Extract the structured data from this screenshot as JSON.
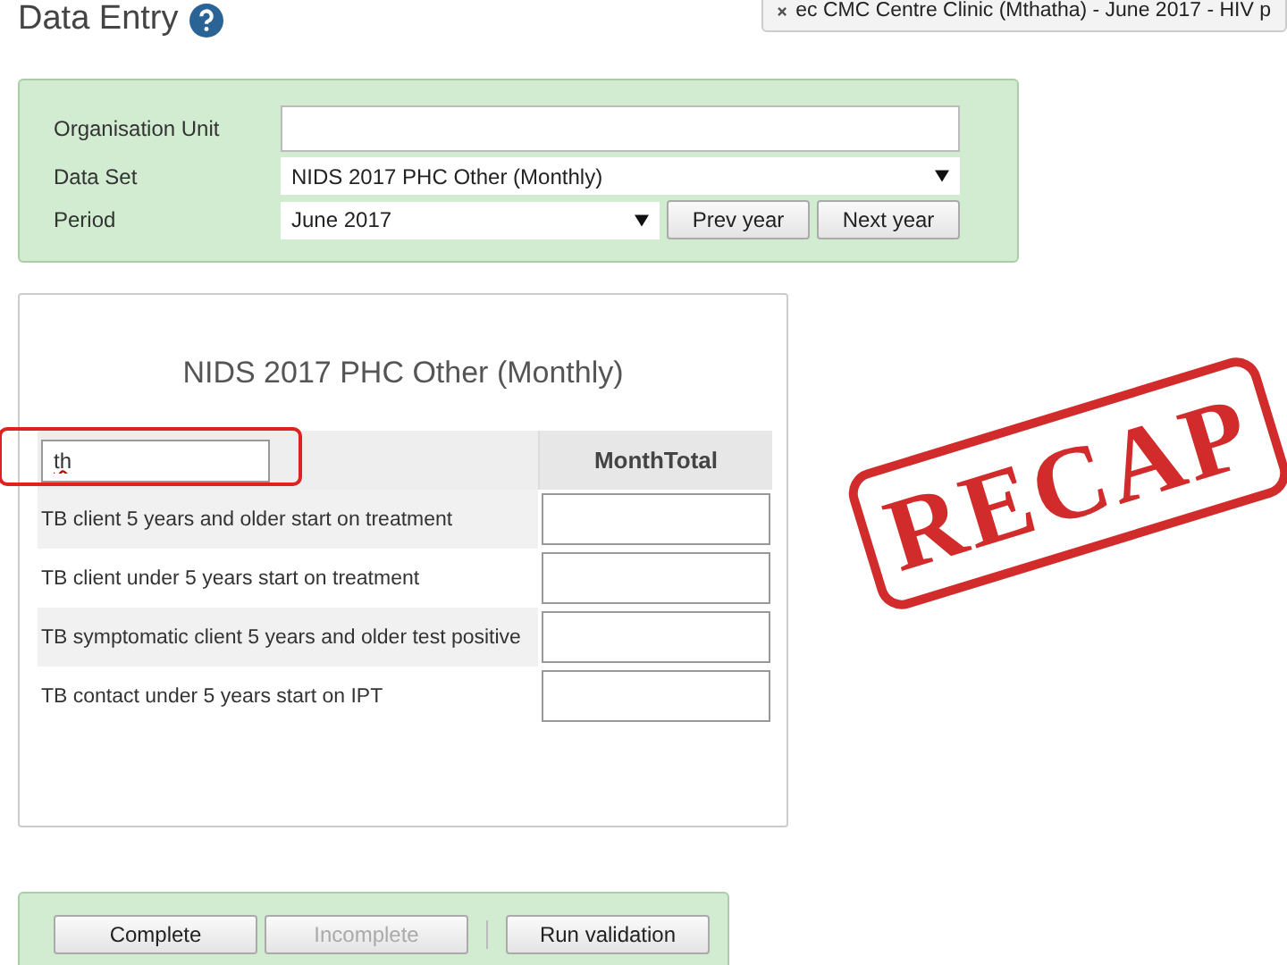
{
  "page": {
    "title": "Data Entry"
  },
  "context_tab": {
    "text": "ec CMC Centre Clinic (Mthatha) - June 2017 - HIV p"
  },
  "selection": [
    {
      "label": "Organisation Unit",
      "kind": "text"
    },
    {
      "label": "Data Set",
      "kind": "select",
      "value": "NIDS 2017 PHC Other (Monthly)"
    },
    {
      "label": "Period",
      "kind": "select",
      "value": "June 2017",
      "buttons": [
        "Prev year",
        "Next year"
      ]
    }
  ],
  "form": {
    "title": "NIDS 2017 PHC Other (Monthly)",
    "filter": {
      "value": "th",
      "highlighted": true
    },
    "column": "MonthTotal",
    "rows": [
      {
        "label": "TB client 5 years and older start on treatment"
      },
      {
        "label": "TB client under 5 years start on treatment"
      },
      {
        "label": "TB symptomatic client 5 years and older test positive"
      },
      {
        "label": "TB contact under 5 years start on IPT"
      }
    ]
  },
  "actions": [
    {
      "label": "Complete",
      "disabled": false
    },
    {
      "label": "Incomplete",
      "disabled": true
    },
    {
      "kind": "separator"
    },
    {
      "label": "Run validation",
      "disabled": false
    }
  ],
  "stamp": {
    "text": "RECAP"
  }
}
